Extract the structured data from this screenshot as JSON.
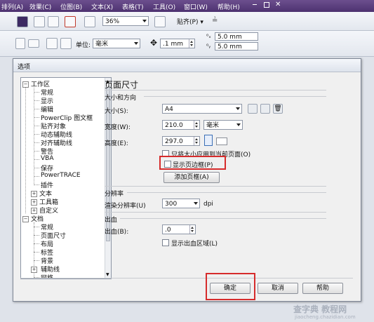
{
  "menu": {
    "items": [
      "排列(A)",
      "效果(C)",
      "位图(B)",
      "文本(X)",
      "表格(T)",
      "工具(O)",
      "窗口(W)",
      "帮助(H)"
    ]
  },
  "toolbar1": {
    "zoom": "36%",
    "snap": "贴齐(P)"
  },
  "toolbar2": {
    "unit_label": "单位:",
    "unit": "毫米",
    "nudge": ".1 mm",
    "dup_x": "5.0 mm",
    "dup_y": "5.0 mm"
  },
  "dialog": {
    "title": "选项",
    "tree": {
      "workspace": "工作区",
      "workspace_children": [
        "常规",
        "显示",
        "编辑",
        "PowerClip 图文框",
        "贴齐对象",
        "动态辅助线",
        "对齐辅助线",
        "警告",
        "VBA",
        "保存",
        "PowerTRACE",
        "插件"
      ],
      "text": "文本",
      "toolbox": "工具箱",
      "customize": "自定义",
      "document": "文档",
      "document_children": [
        "常规",
        "页面尺寸",
        "布局",
        "标签",
        "背景"
      ],
      "guidelines": "辅助线",
      "grid": "网格"
    },
    "panel": {
      "title": "页面尺寸",
      "section_size": "大小和方向",
      "size_label": "大小(S):",
      "size_value": "A4",
      "width_label": "宽度(W):",
      "width_value": "210.0",
      "width_unit": "毫米",
      "height_label": "高度(E):",
      "height_value": "297.0",
      "apply_current": "只将大小应用到当前页面(O)",
      "show_border": "显示页边框(P)",
      "add_frame": "添加页框(A)",
      "section_resolution": "分辨率",
      "render_label": "渲染分辨率(U)",
      "render_value": "300",
      "render_unit": "dpi",
      "section_bleed": "出血",
      "bleed_label": "出血(B):",
      "bleed_value": ".0",
      "show_bleed": "显示出血区域(L)"
    },
    "buttons": {
      "ok": "确定",
      "cancel": "取消",
      "help": "帮助"
    }
  },
  "watermark": {
    "line1": "查字典 教程网",
    "line2": "jiaocheng.chazidian.com"
  },
  "colors": {
    "menubar": "#5a3d7c",
    "highlight_red": "#d62c2c"
  }
}
